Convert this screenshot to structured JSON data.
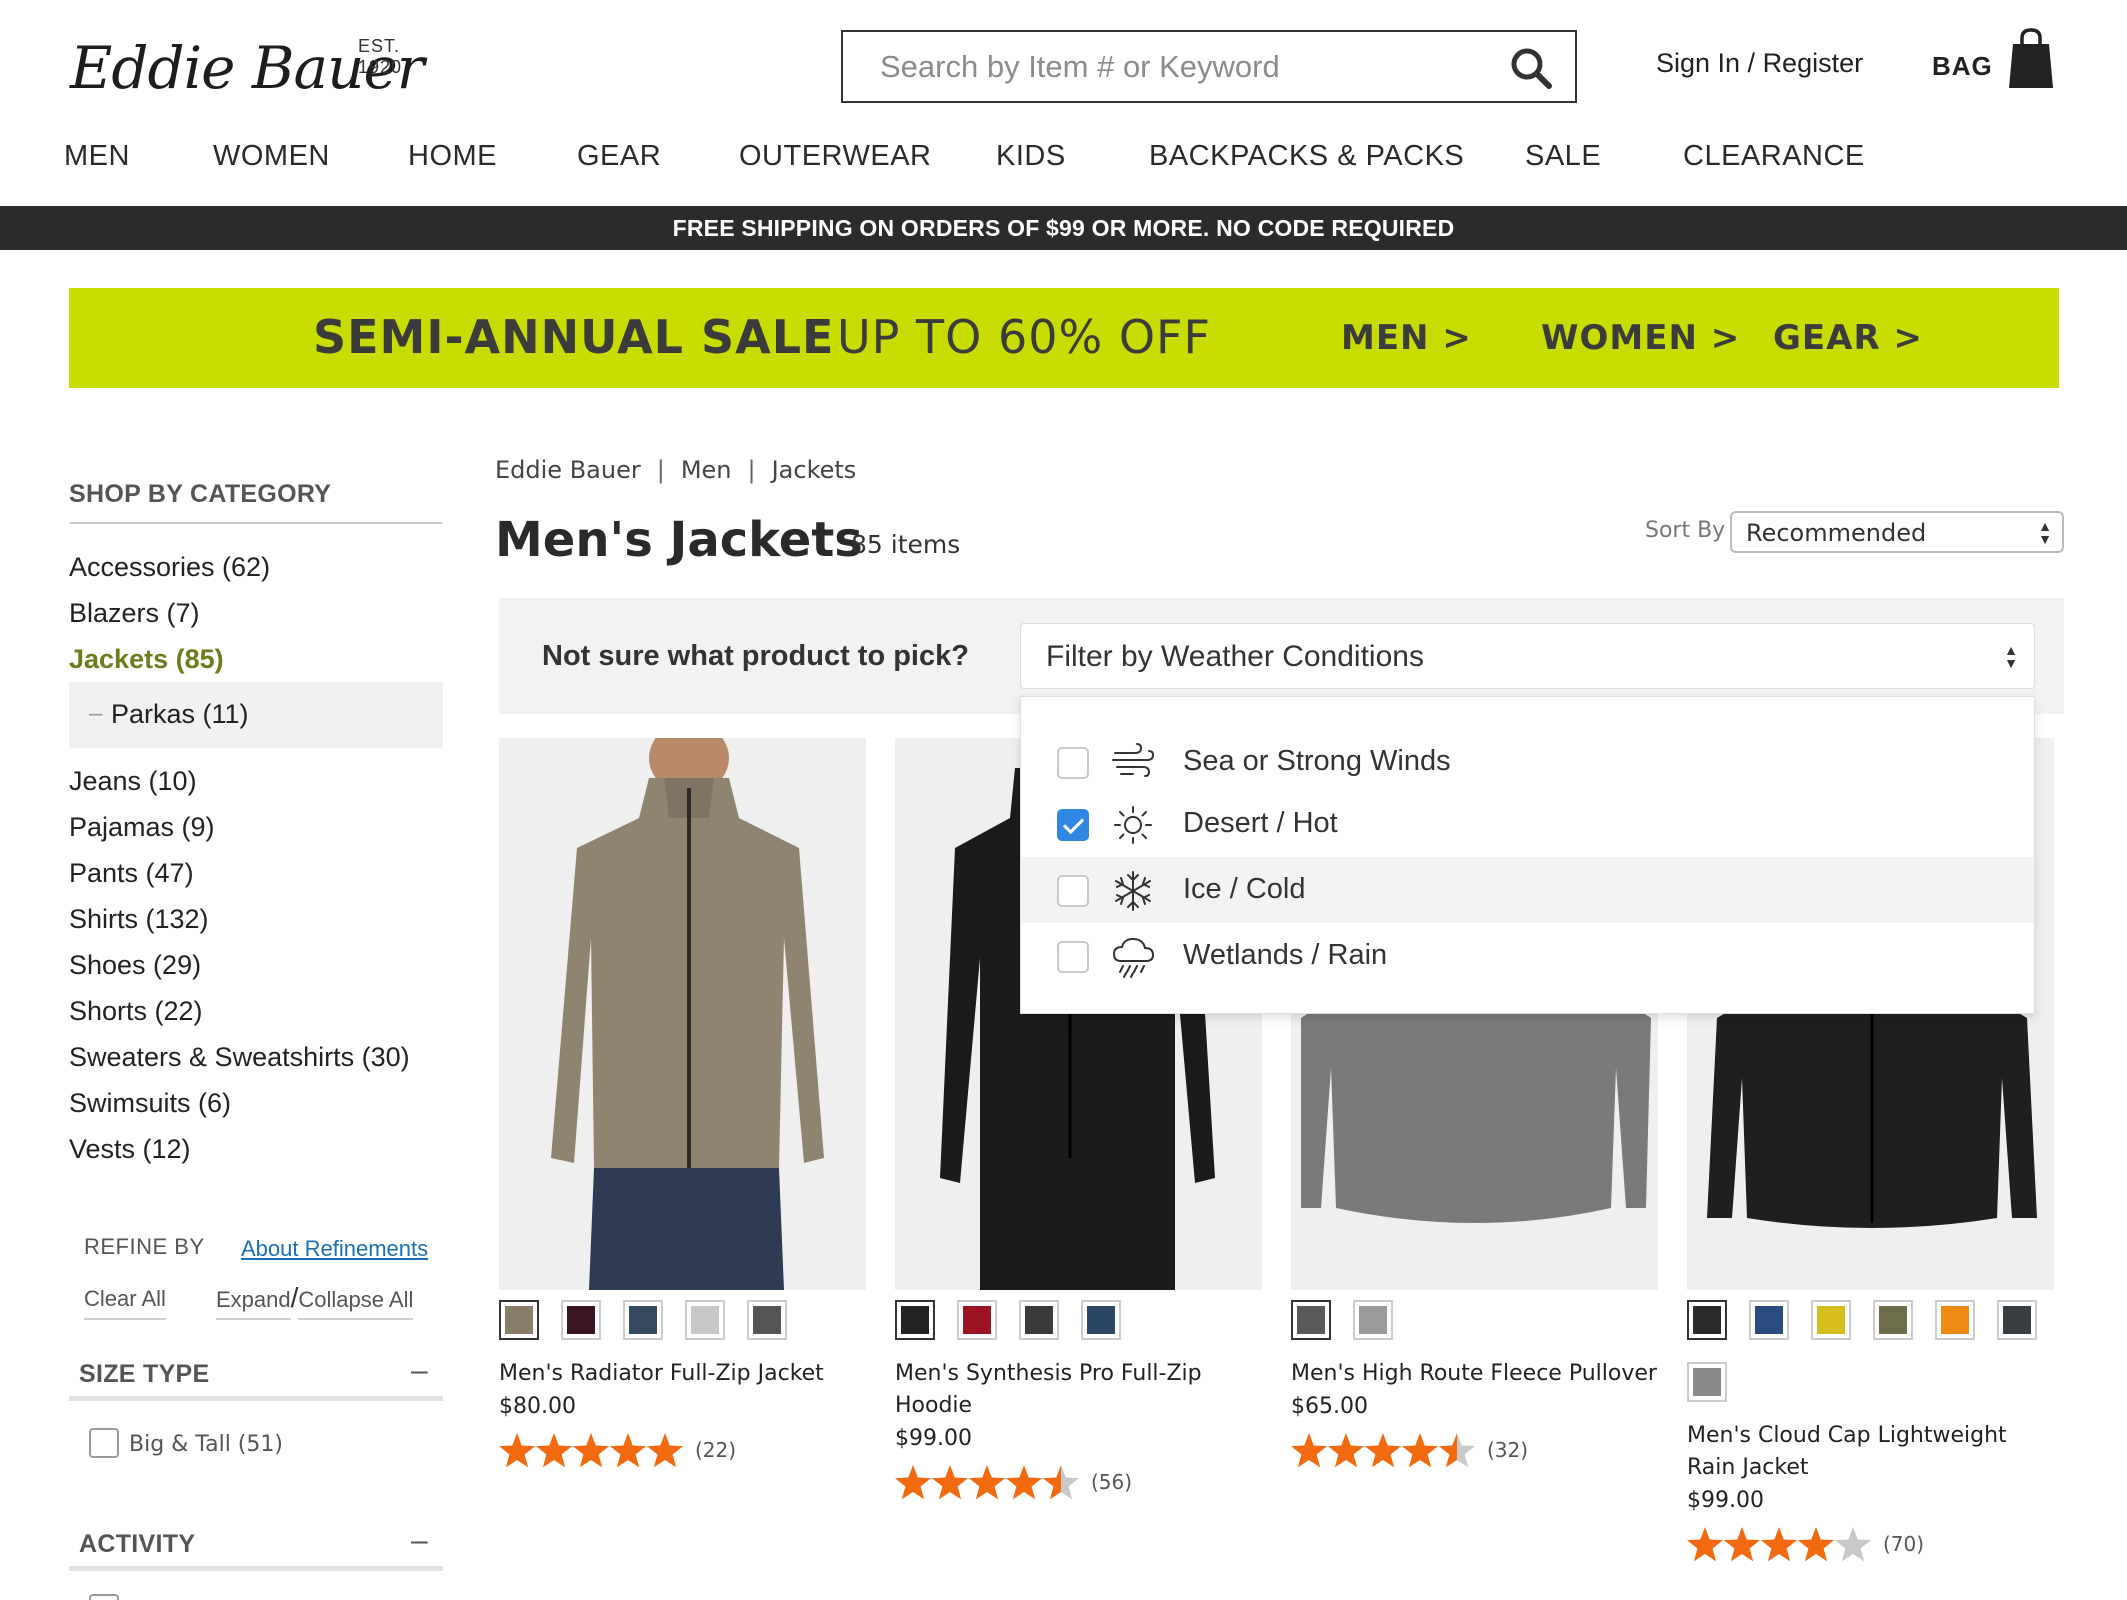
{
  "header": {
    "logo_text": "Eddie Bauer",
    "logo_est": "EST. 1920",
    "search_placeholder": "Search by Item # or Keyword",
    "signin": "Sign In / Register",
    "bag": "BAG"
  },
  "nav": [
    "MEN",
    "WOMEN",
    "HOME",
    "GEAR",
    "OUTERWEAR",
    "KIDS",
    "BACKPACKS & PACKS",
    "SALE",
    "CLEARANCE"
  ],
  "promo": "FREE SHIPPING ON ORDERS OF $99 OR MORE. NO CODE REQUIRED",
  "sale_banner": {
    "bold": "SEMI-ANNUAL SALE",
    "light": "UP TO 60% OFF",
    "links": [
      "MEN >",
      "WOMEN >",
      "GEAR >"
    ],
    "color": "#c7dc00"
  },
  "sidebar": {
    "heading": "SHOP BY CATEGORY",
    "categories": [
      "Accessories (62)",
      "Blazers (7)",
      "Jackets (85)",
      "Jeans (10)",
      "Pajamas (9)",
      "Pants (47)",
      "Shirts (132)",
      "Shoes (29)",
      "Shorts (22)",
      "Sweaters & Sweatshirts (30)",
      "Swimsuits (6)",
      "Vests (12)"
    ],
    "subcategory": "Parkas (11)",
    "refine_by": "REFINE BY",
    "about_refinements": "About Refinements",
    "clear_all": "Clear All",
    "expand": "Expand",
    "slash": "/",
    "collapse_all": "Collapse All",
    "facets": [
      {
        "title": "SIZE TYPE",
        "toggle": "–",
        "options": [
          "Big & Tall (51)"
        ]
      },
      {
        "title": "ACTIVITY",
        "toggle": "–",
        "options": []
      }
    ]
  },
  "breadcrumb": [
    "Eddie Bauer",
    "Men",
    "Jackets"
  ],
  "breadcrumb_sep": "|",
  "page": {
    "title": "Men's Jackets",
    "count": "85 items",
    "sort_label": "Sort By",
    "sort_value": "Recommended"
  },
  "weather": {
    "question": "Not sure what product to pick?",
    "select_label": "Filter by Weather Conditions",
    "options": [
      {
        "label": "Sea or Strong Winds",
        "checked": false,
        "icon": "wind-icon"
      },
      {
        "label": "Desert / Hot",
        "checked": true,
        "icon": "sun-icon"
      },
      {
        "label": "Ice / Cold",
        "checked": false,
        "icon": "snowflake-icon"
      },
      {
        "label": "Wetlands / Rain",
        "checked": false,
        "icon": "rain-cloud-icon"
      }
    ]
  },
  "products": [
    {
      "name": "Men's Radiator Full-Zip Jacket",
      "price": "$80.00",
      "rating": 5,
      "reviews": "(22)",
      "swatches": [
        "#8a7d68",
        "#3a1520",
        "#34495e",
        "#c8c8c8",
        "#555555"
      ]
    },
    {
      "name": "Men's Synthesis Pro Full-Zip Hoodie",
      "price": "$99.00",
      "rating": 4.5,
      "reviews": "(56)",
      "swatches": [
        "#222222",
        "#9a1424",
        "#3a3a3a",
        "#2c4766"
      ]
    },
    {
      "name": "Men's High Route Fleece Pullover",
      "price": "$65.00",
      "rating": 4.5,
      "reviews": "(32)",
      "swatches": [
        "#5a5a5a",
        "#9a9a9a"
      ]
    },
    {
      "name": "Men's Cloud Cap Lightweight Rain Jacket",
      "price": "$99.00",
      "rating": 4,
      "reviews": "(70)",
      "swatches": [
        "#2a2a2a",
        "#2b4c7e",
        "#d6be1a",
        "#6e6d4a",
        "#ec8a12",
        "#3a3d40",
        "#8a8a8a"
      ]
    }
  ],
  "colors": {
    "accent_green": "#6b7d1c",
    "star": "#f26a10",
    "check_blue": "#2f87e2",
    "link_blue": "#1a6fb5"
  }
}
